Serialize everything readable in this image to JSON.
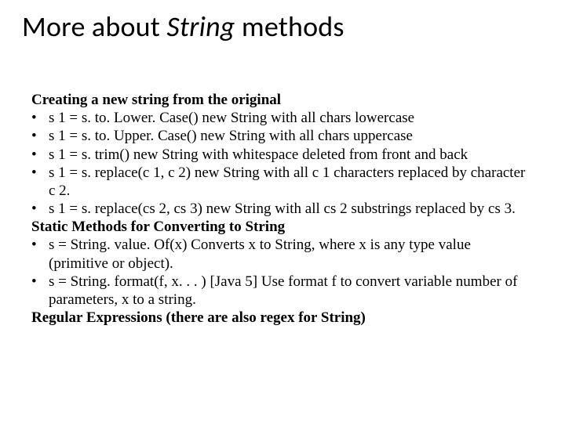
{
  "title_plain": "More about ",
  "title_italic": "String",
  "title_tail": " methods",
  "section1": "Creating a new string from the original",
  "bullets1": [
    "s 1 =   s. to. Lower. Case()   new String with all chars lowercase",
    "s 1 =   s. to. Upper. Case()   new String with all chars uppercase",
    "s 1 =   s. trim()                       new String with whitespace deleted from front and back",
    "s 1 =   s. replace(c 1, c 2)   new String with all c 1 characters replaced by character c 2.",
    "s 1 =   s. replace(cs 2, cs 3)             new String with all cs 2 substrings replaced by cs 3."
  ],
  "section2": "Static Methods for Converting to String",
  "bullets2": [
    "s =    String. value. Of(x)                   Converts x to String, where x is any type value (primitive or object).",
    "s =    String. format(f, x. . . )             [Java 5] Use format f to convert variable number of parameters, x to a string."
  ],
  "section3": "Regular Expressions (there are also regex for String)",
  "dot": "•"
}
